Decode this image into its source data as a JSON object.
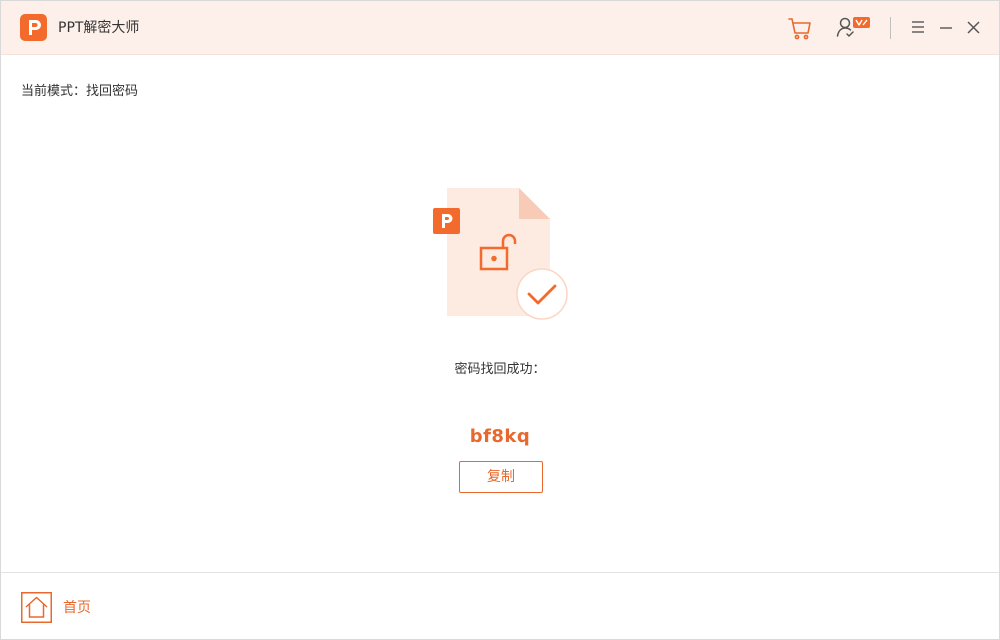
{
  "app": {
    "title": "PPT解密大师",
    "accent_color": "#f26b2c",
    "logo_icon": "ppt-logo-icon"
  },
  "titlebar": {
    "icons": [
      "cart-icon",
      "user-vip-icon",
      "menu-icon",
      "minimize-icon",
      "close-icon"
    ]
  },
  "mode": {
    "label": "当前模式：找回密码"
  },
  "result": {
    "success_text": "密码找回成功：",
    "password": "bf8kq",
    "copy_label": "复制",
    "illustration_icons": [
      "ppt-file-icon",
      "unlock-icon",
      "check-circle-icon"
    ]
  },
  "footer": {
    "home_label": "首页"
  }
}
